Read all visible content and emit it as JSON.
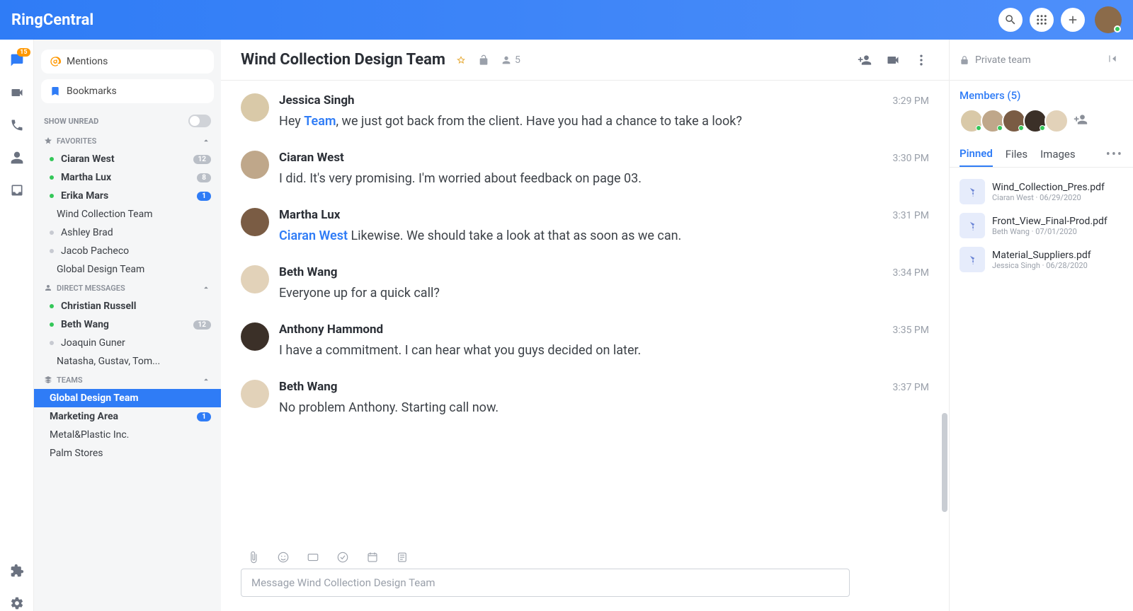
{
  "brand": "RingCentral",
  "rail_badge": "15",
  "sidebar": {
    "mentions": "Mentions",
    "bookmarks": "Bookmarks",
    "show_unread": "SHOW UNREAD",
    "favorites_hdr": "FAVORITES",
    "favorites": [
      {
        "label": "Ciaran West",
        "badge": "12",
        "online": true,
        "bold": true
      },
      {
        "label": "Martha Lux",
        "badge": "8",
        "online": true,
        "bold": true
      },
      {
        "label": "Erika Mars",
        "badge": "1",
        "online": true,
        "bold": true,
        "badgeBlue": true
      },
      {
        "label": "Wind Collection Team"
      },
      {
        "label": "Ashley Brad",
        "offline": true
      },
      {
        "label": "Jacob Pacheco",
        "offline": true
      },
      {
        "label": "Global Design Team"
      }
    ],
    "dm_hdr": "DIRECT MESSAGES",
    "dms": [
      {
        "label": "Christian Russell",
        "online": true,
        "bold": true
      },
      {
        "label": "Beth Wang",
        "online": true,
        "bold": true,
        "badge": "12"
      },
      {
        "label": "Joaquin Guner",
        "offline": true
      },
      {
        "label": "Natasha, Gustav, Tom..."
      }
    ],
    "teams_hdr": "TEAMS",
    "teams": [
      {
        "label": "Global Design Team",
        "selected": true,
        "bold": true
      },
      {
        "label": "Marketing Area",
        "bold": true,
        "badge": "1",
        "badgeBlue": true
      },
      {
        "label": "Metal&Plastic Inc."
      },
      {
        "label": "Palm Stores"
      }
    ]
  },
  "chat": {
    "title": "Wind Collection Design Team",
    "member_count": "5",
    "messages": [
      {
        "name": "Jessica Singh",
        "time": "3:29 PM",
        "pre": "Hey ",
        "mention": "Team",
        "post": ", we just got back from the client. Have you had a chance to take a look?",
        "av": "c1"
      },
      {
        "name": "Ciaran West",
        "time": "3:30 PM",
        "text": "I did. It's very promising. I'm worried about feedback on page 03.",
        "av": "c2"
      },
      {
        "name": "Martha Lux",
        "time": "3:31 PM",
        "mention": "Ciaran West",
        "post": " Likewise. We should take a look at that as soon as we can.",
        "av": "c3"
      },
      {
        "name": "Beth Wang",
        "time": "3:34 PM",
        "text": "Everyone up for a quick call?",
        "av": "c4"
      },
      {
        "name": "Anthony Hammond",
        "time": "3:35 PM",
        "text": "I have a commitment. I can hear what you guys decided on later.",
        "av": "c5"
      },
      {
        "name": "Beth Wang",
        "time": "3:37 PM",
        "text": "No problem Anthony. Starting call now.",
        "av": "c4"
      }
    ],
    "composer_placeholder": "Message Wind Collection Design Team"
  },
  "details": {
    "private": "Private team",
    "members_label": "Members (5)",
    "tabs": {
      "pinned": "Pinned",
      "files": "Files",
      "images": "Images"
    },
    "pinned": [
      {
        "title": "Wind_Collection_Pres.pdf",
        "meta": "Ciaran West · 06/29/2020"
      },
      {
        "title": "Front_View_Final-Prod.pdf",
        "meta": "Beth Wang · 07/01/2020"
      },
      {
        "title": "Material_Suppliers.pdf",
        "meta": "Jessica Singh · 06/28/2020"
      }
    ]
  }
}
